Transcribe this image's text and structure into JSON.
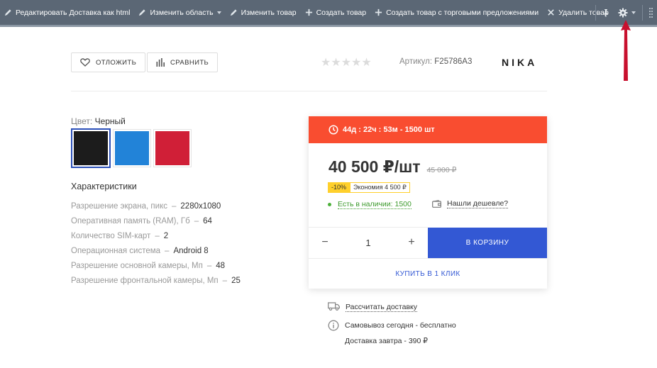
{
  "admin_toolbar": {
    "items": [
      {
        "label": "Редактировать Доставка как html",
        "icon": "pencil-icon"
      },
      {
        "label": "Изменить область",
        "icon": "pencil-icon",
        "has_dropdown": true
      },
      {
        "label": "Изменить товар",
        "icon": "pencil-icon"
      },
      {
        "label": "Создать товар",
        "icon": "plus-icon"
      },
      {
        "label": "Создать товар с торговыми предложениями",
        "icon": "plus-icon"
      },
      {
        "label": "Удалить товар",
        "icon": "close-icon"
      }
    ],
    "right_icons": [
      "pin-icon",
      "gear-icon",
      "drag-handle-icon"
    ]
  },
  "actions": {
    "defer_label": "ОТЛОЖИТЬ",
    "compare_label": "СРАВНИТЬ"
  },
  "rating": {
    "stars": "★★★★★",
    "value": 0,
    "max": 5
  },
  "sku": {
    "label": "Артикул:",
    "value": "F25786A3"
  },
  "brand": "NIKA",
  "color": {
    "label": "Цвет:",
    "selected": "Черный",
    "swatches": [
      {
        "name": "black",
        "hex": "#1c1c1c",
        "active": true
      },
      {
        "name": "blue",
        "hex": "#2283d8",
        "active": false
      },
      {
        "name": "red",
        "hex": "#d01f37",
        "active": false
      }
    ]
  },
  "characteristics": {
    "title": "Характеристики",
    "rows": [
      {
        "name": "Разрешение экрана, пикс",
        "value": "2280x1080"
      },
      {
        "name": "Оперативная память (RAM), Гб",
        "value": "64"
      },
      {
        "name": "Количество SIM-карт",
        "value": "2"
      },
      {
        "name": "Операционная система",
        "value": "Android 8"
      },
      {
        "name": "Разрешение основной камеры, Мп",
        "value": "48"
      },
      {
        "name": "Разрешение фронтальной камеры, Мп",
        "value": "25"
      }
    ]
  },
  "offer": {
    "timer_text": "44д : 22ч : 53м  -  1500 шт",
    "price": "40 500 ₽/шт",
    "old_price": "45 000 ₽",
    "discount": "-10%",
    "savings": "Экономия 4 500 ₽",
    "availability": "Есть в наличии: 1500",
    "cheaper": "Нашли дешевле?",
    "quantity": "1",
    "minus": "−",
    "plus": "+",
    "cart_label": "В КОРЗИНУ",
    "one_click_label": "КУПИТЬ В 1 КЛИК"
  },
  "delivery": {
    "calc_label": "Рассчитать доставку",
    "pickup": "Самовывоз сегодня - бесплатно",
    "tomorrow": "Доставка завтра - 390 ₽"
  },
  "colors": {
    "accent_blue": "#3358d4",
    "timer_red": "#f94d30",
    "stock_green": "#3c9a2c",
    "admin_bar": "#5b6775",
    "arrow_red": "#c8102e"
  }
}
